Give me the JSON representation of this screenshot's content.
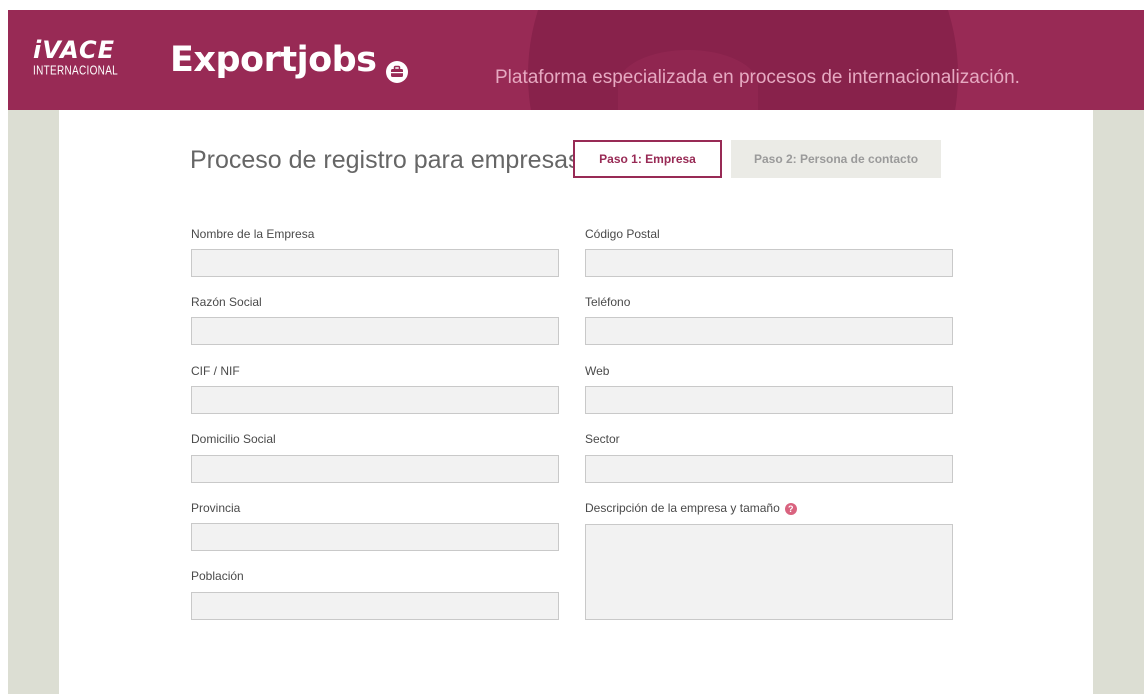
{
  "header": {
    "logo_main": "iVACE",
    "logo_sub": "INTERNACIONAL",
    "brand": "Exportjobs",
    "tagline": "Plataforma especializada en procesos de internacionalización."
  },
  "form": {
    "title": "Proceso de registro para empresas",
    "steps": [
      {
        "label": "Paso 1: Empresa",
        "active": true
      },
      {
        "label": "Paso 2: Persona de contacto",
        "active": false
      }
    ],
    "fields_left": [
      {
        "label": "Nombre de la Empresa",
        "value": ""
      },
      {
        "label": "Razón Social",
        "value": ""
      },
      {
        "label": "CIF / NIF",
        "value": ""
      },
      {
        "label": "Domicilio Social",
        "value": ""
      },
      {
        "label": "Provincia",
        "value": ""
      },
      {
        "label": "Población",
        "value": ""
      }
    ],
    "fields_right": [
      {
        "label": "Código Postal",
        "value": ""
      },
      {
        "label": "Teléfono",
        "value": ""
      },
      {
        "label": "Web",
        "value": ""
      },
      {
        "label": "Sector",
        "value": ""
      },
      {
        "label": "Descripción de la empresa y tamaño",
        "value": "",
        "help_icon": "question-icon"
      }
    ]
  },
  "colors": {
    "brand": "#982a55",
    "tagline": "#e6a9c1",
    "side": "#dcded3",
    "help": "#d9637f"
  }
}
